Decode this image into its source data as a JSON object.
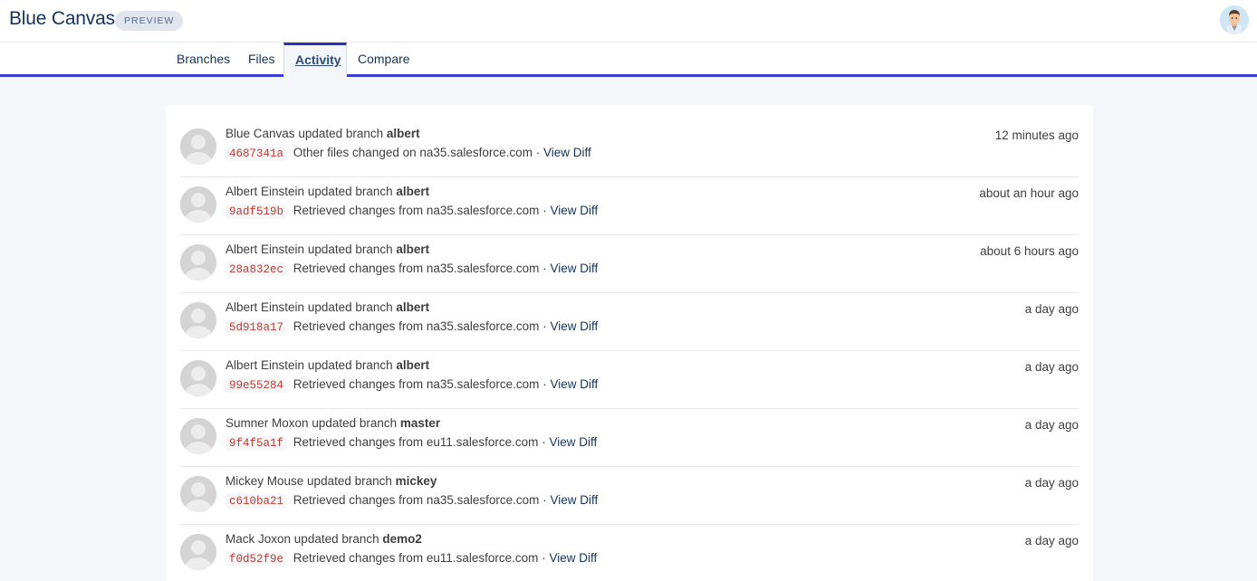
{
  "app": {
    "title": "Blue Canvas",
    "badge": "PREVIEW"
  },
  "tabs": [
    {
      "label": "Branches"
    },
    {
      "label": "Files"
    },
    {
      "label": "Activity"
    },
    {
      "label": "Compare"
    }
  ],
  "activity": [
    {
      "actor": "Blue Canvas",
      "action": "updated branch",
      "branch": "albert",
      "sha": "4687341a",
      "message": "Other files changed on na35.salesforce.com",
      "sep": "·",
      "link": "View Diff",
      "time": "12 minutes ago"
    },
    {
      "actor": "Albert Einstein",
      "action": "updated branch",
      "branch": "albert",
      "sha": "9adf519b",
      "message": "Retrieved changes from na35.salesforce.com",
      "sep": "·",
      "link": "View Diff",
      "time": "about an hour ago"
    },
    {
      "actor": "Albert Einstein",
      "action": "updated branch",
      "branch": "albert",
      "sha": "28a832ec",
      "message": "Retrieved changes from na35.salesforce.com",
      "sep": "·",
      "link": "View Diff",
      "time": "about 6 hours ago"
    },
    {
      "actor": "Albert Einstein",
      "action": "updated branch",
      "branch": "albert",
      "sha": "5d918a17",
      "message": "Retrieved changes from na35.salesforce.com",
      "sep": "·",
      "link": "View Diff",
      "time": "a day ago"
    },
    {
      "actor": "Albert Einstein",
      "action": "updated branch",
      "branch": "albert",
      "sha": "99e55284",
      "message": "Retrieved changes from na35.salesforce.com",
      "sep": "·",
      "link": "View Diff",
      "time": "a day ago"
    },
    {
      "actor": "Sumner Moxon",
      "action": "updated branch",
      "branch": "master",
      "sha": "9f4f5a1f",
      "message": "Retrieved changes from eu11.salesforce.com",
      "sep": "·",
      "link": "View Diff",
      "time": "a day ago"
    },
    {
      "actor": "Mickey Mouse",
      "action": "updated branch",
      "branch": "mickey",
      "sha": "c610ba21",
      "message": "Retrieved changes from na35.salesforce.com",
      "sep": "·",
      "link": "View Diff",
      "time": "a day ago"
    },
    {
      "actor": "Mack Joxon",
      "action": "updated branch",
      "branch": "demo2",
      "sha": "f0d52f9e",
      "message": "Retrieved changes from eu11.salesforce.com",
      "sep": "·",
      "link": "View Diff",
      "time": "a day ago"
    }
  ],
  "colors": {
    "accent": "#3b3fd8",
    "sha": "#c23934",
    "text": "#3e3e3c",
    "title": "#16325c"
  },
  "icons": {
    "user_avatar": "user-avatar-icon",
    "row_avatar": "default-avatar-icon"
  }
}
